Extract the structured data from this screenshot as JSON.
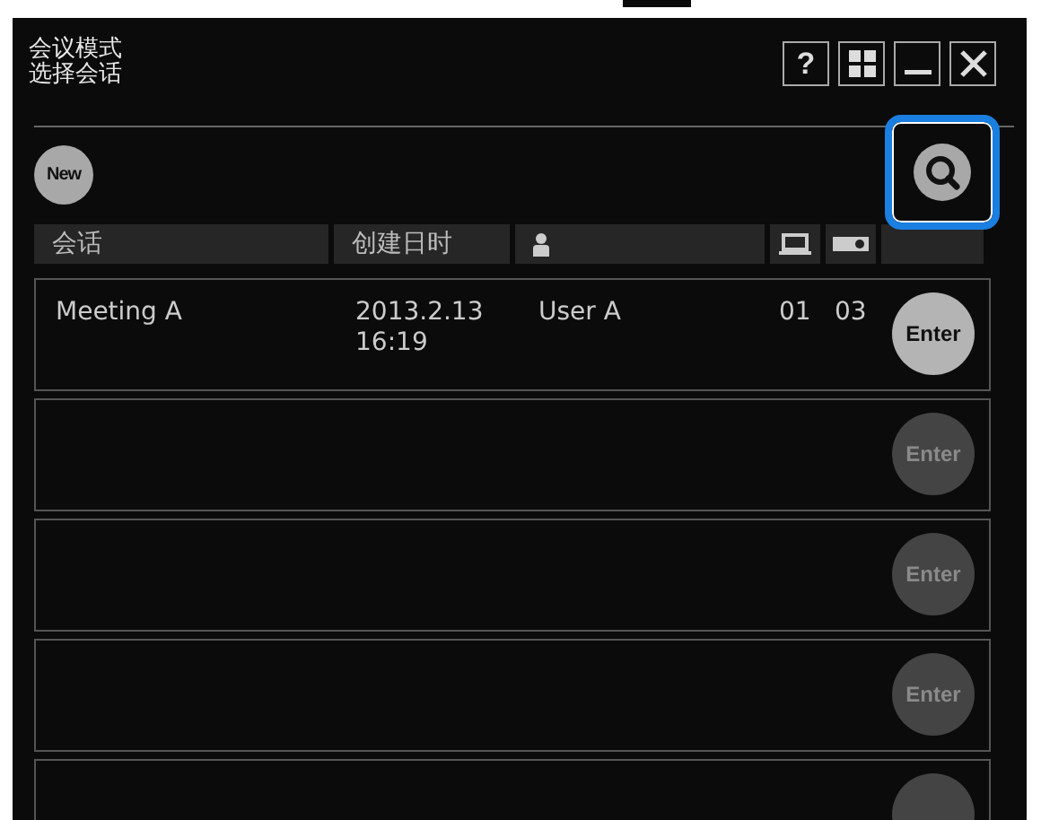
{
  "window": {
    "title_lines": [
      "会议模式",
      "选择会话"
    ]
  },
  "title_buttons": [
    {
      "kind": "help",
      "label": "?"
    },
    {
      "kind": "grid"
    },
    {
      "kind": "minimize"
    },
    {
      "kind": "close"
    }
  ],
  "toolbar": {
    "new_button": "New",
    "search_focused": true
  },
  "table": {
    "columns": [
      {
        "kind": "text",
        "label": "会话"
      },
      {
        "kind": "text",
        "label": "创建日时"
      },
      {
        "kind": "person"
      },
      {
        "kind": "laptop"
      },
      {
        "kind": "projector"
      },
      {
        "kind": "blank"
      }
    ],
    "rows": [
      {
        "session": "Meeting A",
        "created": [
          "2013.2.13",
          "16:19"
        ],
        "user": "User A",
        "pcs": "01",
        "projectors": "03",
        "enter": "Enter",
        "enabled": true
      },
      {
        "enter": "Enter",
        "enabled": false
      },
      {
        "enter": "Enter",
        "enabled": false
      },
      {
        "enter": "Enter",
        "enabled": false
      },
      {
        "enabled": false
      }
    ]
  }
}
